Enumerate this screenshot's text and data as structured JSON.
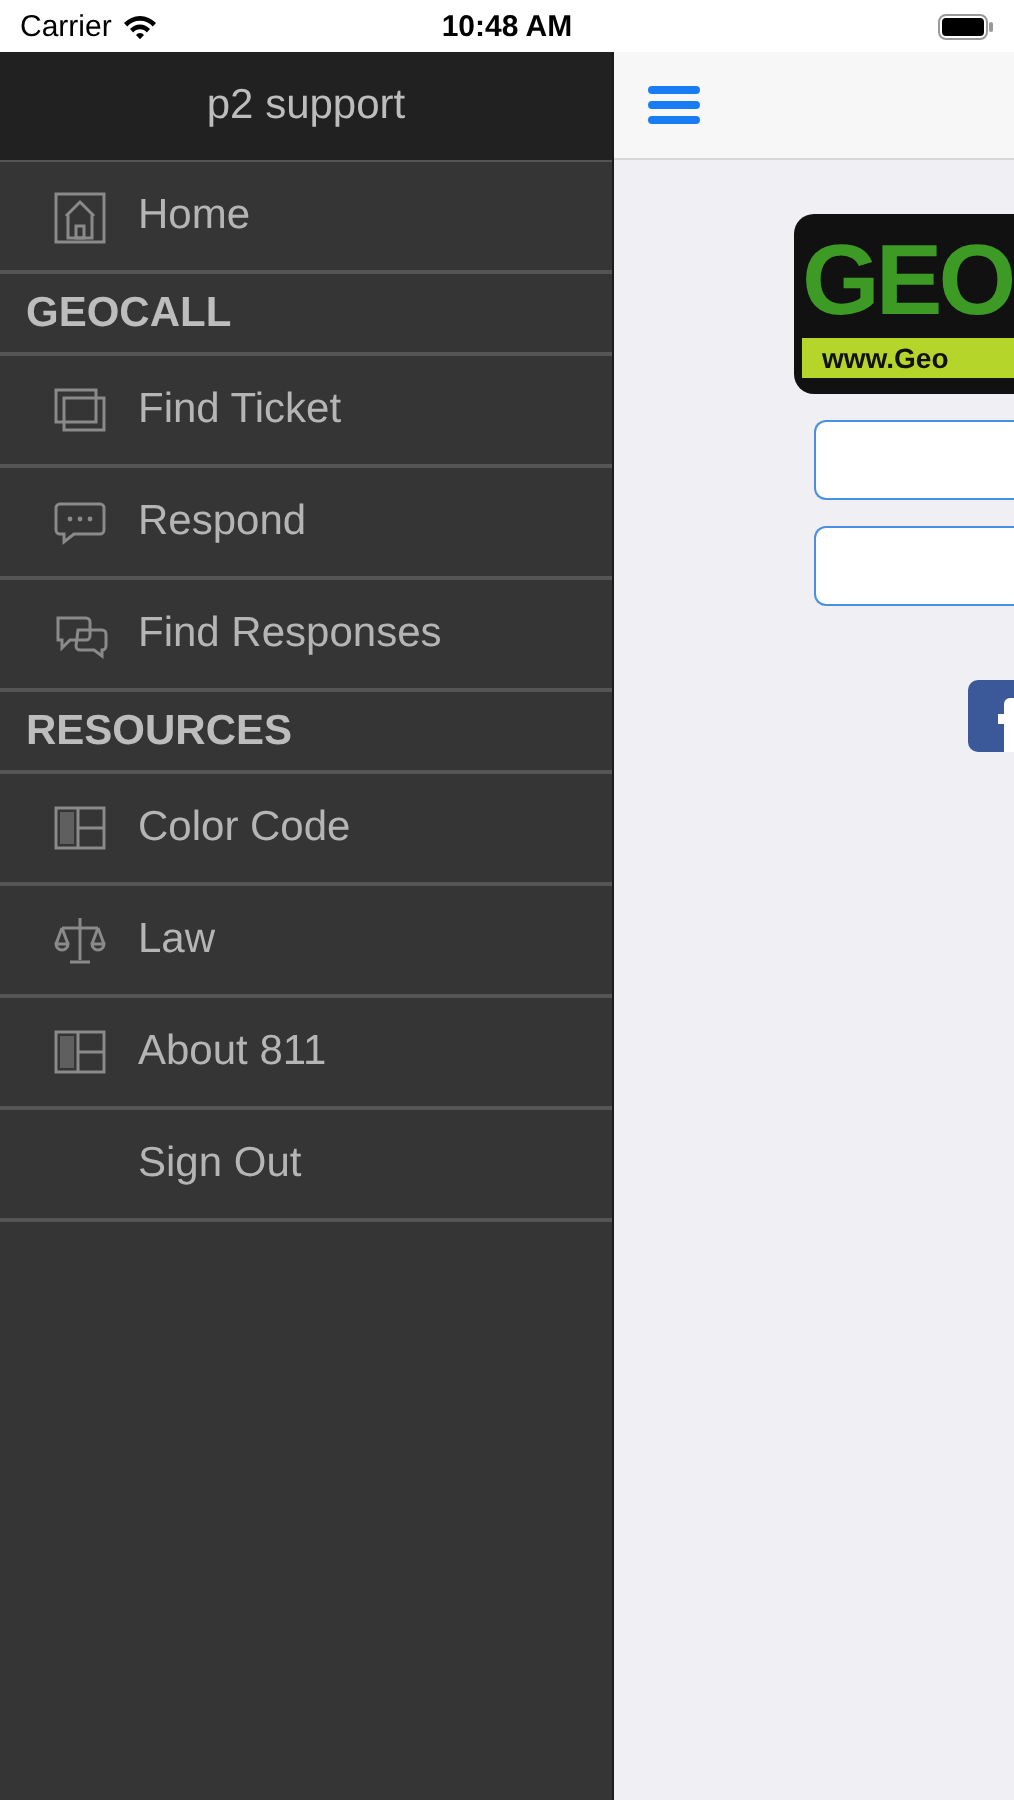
{
  "status_bar": {
    "carrier": "Carrier",
    "time": "10:48 AM"
  },
  "drawer": {
    "title": "p2 support",
    "items": [
      {
        "kind": "item",
        "label": "Home"
      },
      {
        "kind": "section",
        "label": "GEOCALL"
      },
      {
        "kind": "item",
        "label": "Find Ticket"
      },
      {
        "kind": "item",
        "label": "Respond"
      },
      {
        "kind": "item",
        "label": "Find Responses"
      },
      {
        "kind": "section",
        "label": "RESOURCES"
      },
      {
        "kind": "item",
        "label": "Color Code"
      },
      {
        "kind": "item",
        "label": "Law"
      },
      {
        "kind": "item",
        "label": "About 811"
      },
      {
        "kind": "item",
        "label": "Sign Out"
      }
    ]
  },
  "main": {
    "logo": {
      "title": "GEO",
      "url": "www.Geo"
    }
  }
}
